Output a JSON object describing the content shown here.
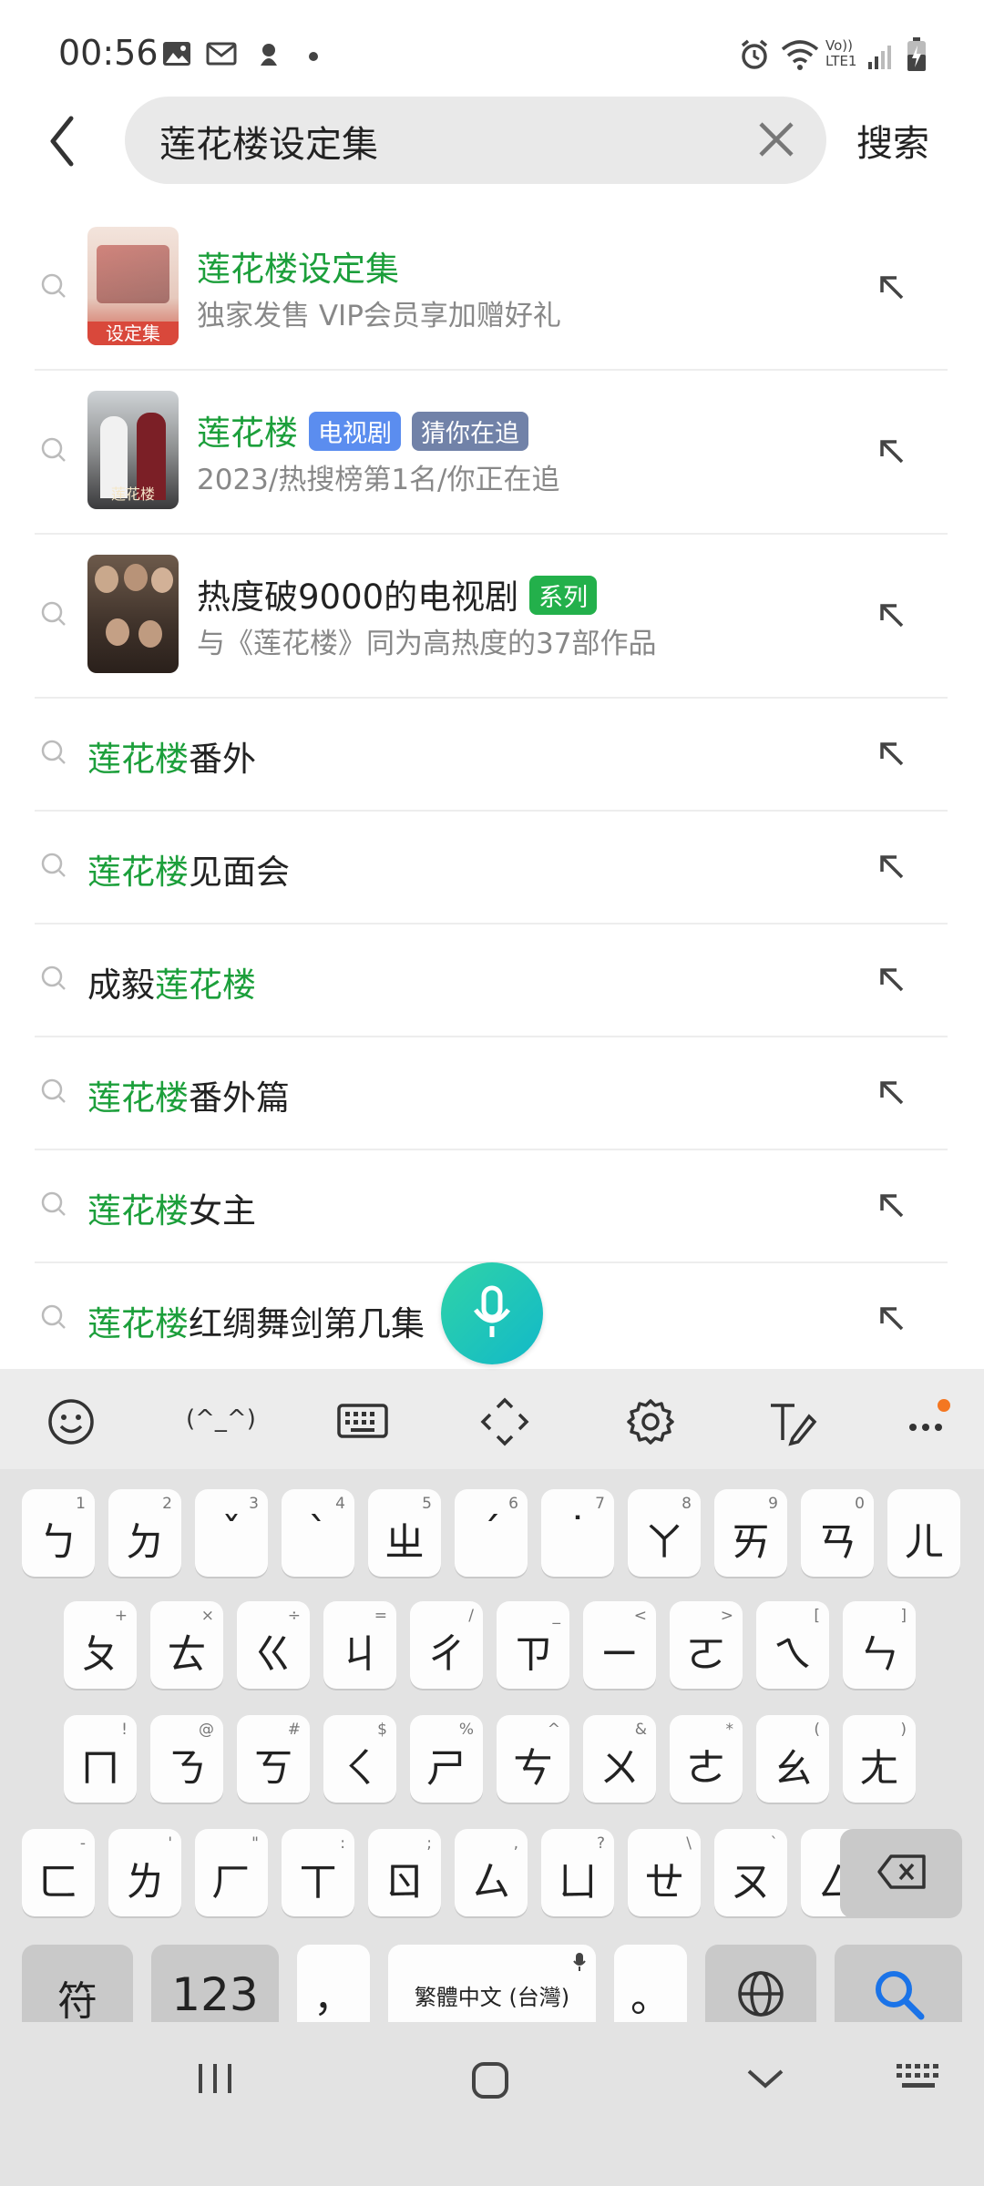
{
  "status": {
    "time": "00:56",
    "net_label": "Vo)) LTE1"
  },
  "search": {
    "query": "莲花楼设定集",
    "submit_label": "搜索"
  },
  "suggestions": {
    "rich": [
      {
        "title": "莲花楼设定集",
        "subtitle": "独家发售 VIP会员享加赠好礼",
        "thumb_label": "设定集"
      },
      {
        "title": "莲花楼",
        "badge1": "电视剧",
        "badge2": "猜你在追",
        "subtitle": "2023/热搜榜第1名/你正在追",
        "thumb_label": "莲花楼"
      },
      {
        "title": "热度破9000的电视剧",
        "badge1": "系列",
        "subtitle": "与《莲花楼》同为高热度的37部作品"
      }
    ],
    "plain": [
      {
        "pre": "",
        "hl": "莲花楼",
        "post": "番外"
      },
      {
        "pre": "",
        "hl": "莲花楼",
        "post": "见面会"
      },
      {
        "pre": "成毅",
        "hl": "莲花楼",
        "post": ""
      },
      {
        "pre": "",
        "hl": "莲花楼",
        "post": "番外篇"
      },
      {
        "pre": "",
        "hl": "莲花楼",
        "post": "女主"
      },
      {
        "pre": "",
        "hl": "莲花楼",
        "post": "红绸舞剑第几集"
      }
    ]
  },
  "keyboard": {
    "toolbar": [
      "emoji-icon",
      "kaomoji",
      "keyboard-icon",
      "move-icon",
      "gear-icon",
      "handwriting-icon",
      "more-icon"
    ],
    "kaomoji_label": "(^_^)",
    "row1": [
      {
        "m": "ㄅ",
        "h": "1"
      },
      {
        "m": "ㄉ",
        "h": "2"
      },
      {
        "m": "ˇ",
        "h": "3"
      },
      {
        "m": "ˋ",
        "h": "4"
      },
      {
        "m": "ㄓ",
        "h": "5"
      },
      {
        "m": "ˊ",
        "h": "6"
      },
      {
        "m": "˙",
        "h": "7"
      },
      {
        "m": "ㄚ",
        "h": "8"
      },
      {
        "m": "ㄞ",
        "h": "9"
      },
      {
        "m": "ㄢ",
        "h": "0"
      },
      {
        "m": "ㄦ",
        "h": ""
      }
    ],
    "row2": [
      {
        "m": "ㄆ",
        "h": "+"
      },
      {
        "m": "ㄊ",
        "h": "×"
      },
      {
        "m": "ㄍ",
        "h": "÷"
      },
      {
        "m": "ㄐ",
        "h": "="
      },
      {
        "m": "ㄔ",
        "h": "/"
      },
      {
        "m": "ㄗ",
        "h": "_"
      },
      {
        "m": "ㄧ",
        "h": "<"
      },
      {
        "m": "ㄛ",
        "h": ">"
      },
      {
        "m": "ㄟ",
        "h": "["
      },
      {
        "m": "ㄣ",
        "h": "]"
      }
    ],
    "row3": [
      {
        "m": "ㄇ",
        "h": "!"
      },
      {
        "m": "ㄋ",
        "h": "@"
      },
      {
        "m": "ㄎ",
        "h": "#"
      },
      {
        "m": "ㄑ",
        "h": "$"
      },
      {
        "m": "ㄕ",
        "h": "%"
      },
      {
        "m": "ㄘ",
        "h": "^"
      },
      {
        "m": "ㄨ",
        "h": "&"
      },
      {
        "m": "ㄜ",
        "h": "*"
      },
      {
        "m": "ㄠ",
        "h": "("
      },
      {
        "m": "ㄤ",
        "h": ")"
      }
    ],
    "row4": [
      {
        "m": "ㄈ",
        "h": "-"
      },
      {
        "m": "ㄌ",
        "h": "'"
      },
      {
        "m": "ㄏ",
        "h": "\""
      },
      {
        "m": "ㄒ",
        "h": ":"
      },
      {
        "m": "ㄖ",
        "h": ";"
      },
      {
        "m": "ㄙ",
        "h": ","
      },
      {
        "m": "ㄩ",
        "h": "?"
      },
      {
        "m": "ㄝ",
        "h": "\\"
      },
      {
        "m": "ㄡ",
        "h": "`"
      },
      {
        "m": "ㄥ",
        "h": "~"
      }
    ],
    "symbols_label": "符",
    "numbers_label": "123",
    "comma_label": "，",
    "space_label": "繁體中文 (台灣)",
    "period_label": "。"
  },
  "colors": {
    "highlight": "#1c9f3b",
    "badge_blue": "#5b8def",
    "badge_slate": "#7182a8",
    "badge_green": "#23b04b",
    "search_key": "#1a73e8"
  }
}
